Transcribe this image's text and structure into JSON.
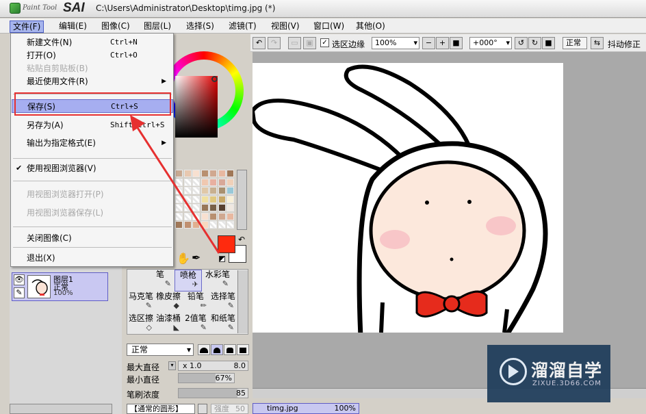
{
  "app": {
    "logo_small": "Paint Tool",
    "logo_big": "SAI",
    "window_title": "C:\\Users\\Administrator\\Desktop\\timg.jpg (*)"
  },
  "menubar": [
    {
      "label": "文件(F)"
    },
    {
      "label": "编辑(E)"
    },
    {
      "label": "图像(C)"
    },
    {
      "label": "图层(L)"
    },
    {
      "label": "选择(S)"
    },
    {
      "label": "滤镜(T)"
    },
    {
      "label": "视图(V)"
    },
    {
      "label": "窗口(W)"
    },
    {
      "label": "其他(O)"
    }
  ],
  "file_menu": [
    {
      "label": "新建文件(N)",
      "shortcut": "Ctrl+N"
    },
    {
      "label": "打开(O)",
      "shortcut": "Ctrl+O"
    },
    {
      "label": "粘贴自剪贴板(B)",
      "shortcut": "",
      "disabled": true
    },
    {
      "label": "最近使用文件(R)",
      "shortcut": "",
      "submenu": true
    },
    {
      "label": "保存(S)",
      "shortcut": "Ctrl+S",
      "highlighted": true
    },
    {
      "label": "另存为(A)",
      "shortcut": "Shift+Ctrl+S"
    },
    {
      "label": "输出为指定格式(E)",
      "shortcut": "",
      "submenu": true
    },
    {
      "label": "使用视图浏览器(V)",
      "shortcut": "",
      "checked": true
    },
    {
      "label": "用视图浏览器打开(P)",
      "shortcut": "",
      "disabled": true
    },
    {
      "label": "用视图浏览器保存(L)",
      "shortcut": "",
      "disabled": true
    },
    {
      "label": "关闭图像(C)",
      "shortcut": ""
    },
    {
      "label": "退出(X)",
      "shortcut": ""
    }
  ],
  "toolbar": {
    "selection_edge": "选区边缘",
    "zoom": "100%",
    "rotation": "+000°",
    "blend_mode": "正常",
    "stabilizer": "抖动修正"
  },
  "layer": {
    "name": "图层1",
    "mode": "正常",
    "opacity": "100%"
  },
  "tools": [
    "笔",
    "喷枪",
    "水彩笔",
    "马克笔",
    "橡皮擦",
    "铅笔",
    "选择笔",
    "选区擦",
    "油漆桶",
    "2值笔",
    "和纸笔"
  ],
  "brush": {
    "blend": "正常",
    "max_size_label": "最大直径",
    "max_size_mult": "x 1.0",
    "max_size_value": "8.0",
    "min_size_label": "最小直径",
    "min_size_value": "67%",
    "min_size_fraction": 0.67,
    "density_label": "笔刷浓度",
    "density_value": "85",
    "density_fraction": 0.85,
    "shape": "【通常的圆形】",
    "strength_label": "强度",
    "strength_value": "50"
  },
  "document_tab": {
    "name": "timg.jpg",
    "zoom": "100%"
  },
  "watermark": {
    "title": "溜溜自学",
    "url": "ZIXUE.3D66.COM"
  },
  "colors": {
    "foreground": "#ff2a0e",
    "background": "#ffffff",
    "highlight": "#e63030",
    "menu_selected": "#a6aef0"
  }
}
